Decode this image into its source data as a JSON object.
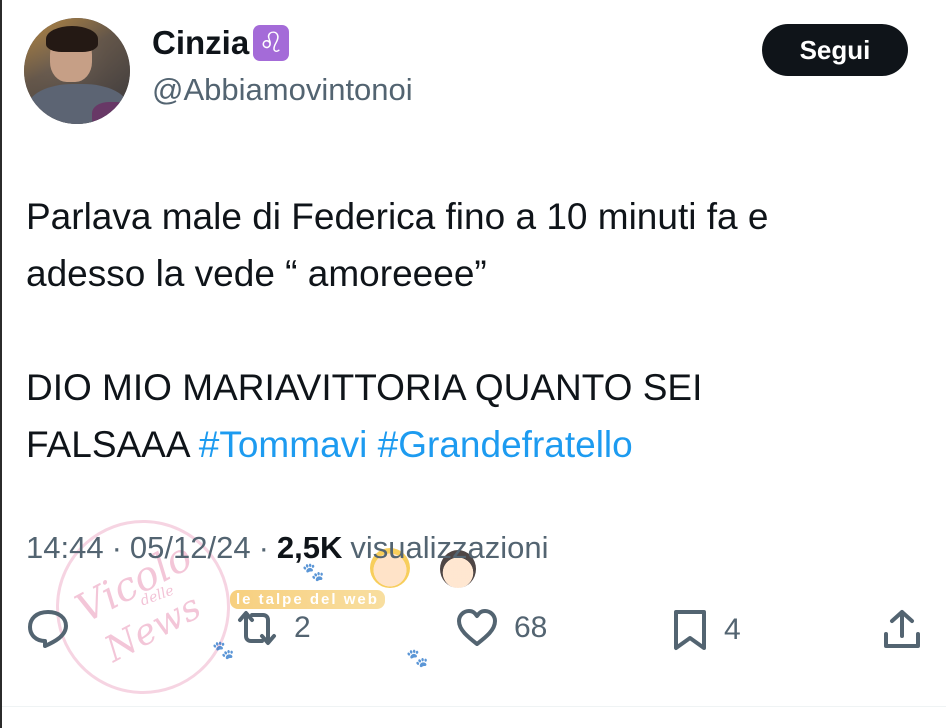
{
  "author": {
    "name": "Cinzia",
    "zodiac_symbol": "♌",
    "handle": "@Abbiamovintonoi"
  },
  "follow_button": {
    "label": "Segui"
  },
  "tweet": {
    "line1": "Parlava male di Federica fino a 10 minuti fa e",
    "line2": "adesso la vede “ amoreeee”",
    "line3": "DIO MIO MARIAVITTORIA QUANTO SEI",
    "line4_text": "FALSAAA",
    "hashtag1": "#Tommavi",
    "hashtag2": "#Grandefratello",
    "hashtag_color": "#1d9bf0"
  },
  "meta": {
    "time": "14:44",
    "sep1": "·",
    "date": "05/12/24",
    "sep2": "·",
    "views_count": "2,5K",
    "views_label": "visualizzazioni"
  },
  "actions": {
    "reply_icon": "reply-icon",
    "retweet_icon": "retweet-icon",
    "retweet_count": "2",
    "like_icon": "heart-icon",
    "like_count": "68",
    "bookmark_icon": "bookmark-icon",
    "bookmark_count": "4",
    "share_icon": "share-icon"
  },
  "watermark": {
    "logo_word1": "Vicolo",
    "logo_word2": "delle",
    "logo_word3": "News",
    "strip_text": "le talpe del web"
  }
}
